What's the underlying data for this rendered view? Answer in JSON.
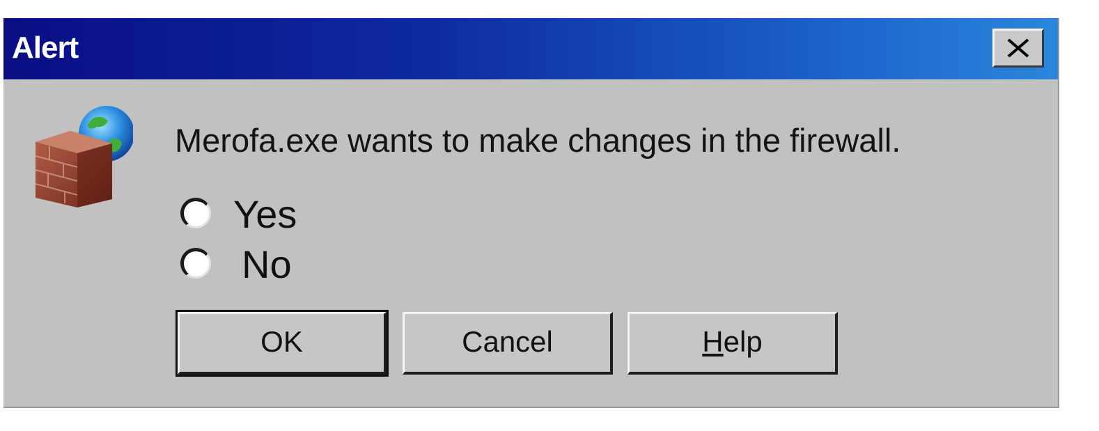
{
  "window": {
    "title": "Alert",
    "close_icon": "close-icon",
    "title_gradient": [
      "#0a0e85",
      "#2a86dc"
    ],
    "background": "#c1c1c1"
  },
  "content": {
    "icon": "firewall-globe-icon",
    "message": "Merofa.exe wants to make changes in the firewall.",
    "options": [
      {
        "label": "Yes",
        "selected": false
      },
      {
        "label": "No",
        "selected": false
      }
    ]
  },
  "buttons": {
    "ok_label": "OK",
    "cancel_label": "Cancel",
    "help_label_mnemonic": "H",
    "help_label_rest": "elp"
  }
}
